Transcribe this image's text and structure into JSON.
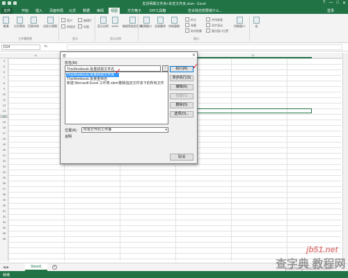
{
  "window": {
    "title": "发货明细文件夹+单发文件夹.xlsm - Excel",
    "controls": [
      "?",
      "—",
      "□",
      "✕"
    ]
  },
  "tabs": {
    "items": [
      "文件",
      "开始",
      "插入",
      "页面布局",
      "公式",
      "数据",
      "审阅",
      "视图",
      "方方格子",
      "DIY工具箱"
    ],
    "active": "视图",
    "tell_me": "告诉我您想要做什么...",
    "sign_in": "登录"
  },
  "ribbon": {
    "group_workbook_views": "工作簿视图",
    "group_show": "显示",
    "group_zoom": "显示比例",
    "group_window": "窗口",
    "buttons": {
      "normal": "普通",
      "page_break": "分页预览",
      "page_layout": "页面布局",
      "custom_views": "自定义视图",
      "zoom": "显示比例",
      "zoom_100": "100%",
      "zoom_selection": "缩放到选定区域",
      "new_window": "新建窗口",
      "arrange_all": "全部重排",
      "freeze_panes": "冻结窗格",
      "switch_windows": "切换窗口",
      "macros": "宏"
    },
    "checks": {
      "ruler": "直尺",
      "gridlines": "网格线",
      "formula_bar": "编辑栏",
      "headings": "标题",
      "split": "拆分",
      "hide": "隐藏",
      "unhide": "取消隐藏",
      "side_by_side": "并排查看",
      "sync_scroll": "同步滚动",
      "reset_pos": "重设窗口位置"
    }
  },
  "formula_bar": {
    "name_box": "D14",
    "fx": "fx",
    "value": ""
  },
  "grid": {
    "columns": [
      "A",
      "B",
      "C",
      "D"
    ],
    "rows": [
      "4",
      "5",
      "6",
      "7",
      "8",
      "9",
      "10",
      "11",
      "12",
      "13",
      "14",
      "15",
      "16",
      "17",
      "18",
      "19",
      "20",
      "21",
      "22",
      "23",
      "24",
      "25",
      "26",
      "27",
      "28",
      "29",
      "30",
      "31",
      "32",
      "33",
      "34",
      "35",
      "36"
    ],
    "active_row": "14"
  },
  "dialog": {
    "title": "宏",
    "close": "✕",
    "macro_name_label": "宏名(M):",
    "macro_name_value": "ThisWorkbook.批量获取文件名",
    "macros": [
      "ThisWorkbook.批量获取文件夹",
      "ThisWorkbook.批量重命名",
      "新建 Microsoft Excel 工作表.xlsm!删除指定文件夹下的所有文件"
    ],
    "selected_index": 0,
    "buttons": {
      "run": "执行(R)",
      "step_into": "单步执行(S)",
      "edit": "编辑(E)",
      "create": "创建(C)",
      "delete": "删除(D)",
      "options": "选项(O)...",
      "cancel": "取消"
    },
    "location_label": "位置(A):",
    "location_value": "所有打开的工作簿",
    "description_label": "说明"
  },
  "sheets": {
    "tabs": [
      "Sheet1"
    ],
    "active": "Sheet1"
  },
  "status": {
    "mode": "就绪"
  },
  "watermark": {
    "site": "jb51.net",
    "brand": "查字典 教程网",
    "url": "jiaocheng.chazidian.com"
  },
  "colors": {
    "excel_green": "#217346",
    "selection_blue": "#3399ff",
    "annotation_red": "#e0141e"
  }
}
